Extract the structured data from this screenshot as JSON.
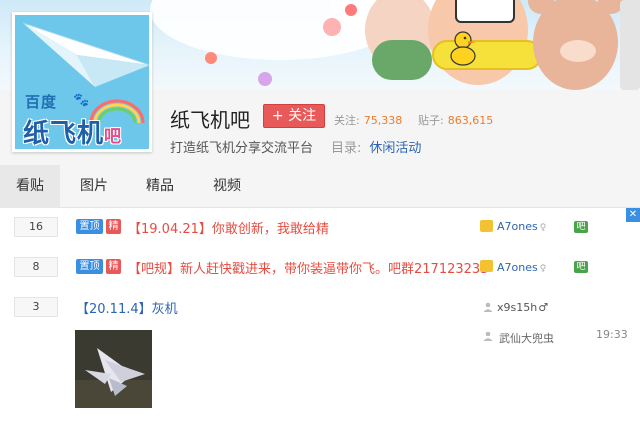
{
  "forum": {
    "name": "纸飞机吧",
    "slogan": "打造纸飞机分享交流平台",
    "logo_sub": "百度",
    "logo_main": "纸飞机",
    "logo_suffix": "吧"
  },
  "follow_button": {
    "label": "+ 关注"
  },
  "stats": {
    "followers_label": "关注:",
    "followers_value": "75,338",
    "posts_label": "贴子:",
    "posts_value": "863,615"
  },
  "catalog": {
    "label": "目录:",
    "value": "休闲活动"
  },
  "tabs": [
    {
      "label": "看贴",
      "active": true
    },
    {
      "label": "图片",
      "active": false
    },
    {
      "label": "精品",
      "active": false
    },
    {
      "label": "视频",
      "active": false
    }
  ],
  "threads": [
    {
      "replies": "16",
      "badge_top": "置顶",
      "badge_jing": "精",
      "title": "【19.04.21】你敢创新，我敢给精",
      "author": "A7ones",
      "author_tail": "♀",
      "forum_icon": "吧"
    },
    {
      "replies": "8",
      "badge_top": "置顶",
      "badge_jing": "精",
      "title": "【吧规】新人赶快戳进来，带你装逼带你飞。吧群217123233",
      "author": "A7ones",
      "author_tail": "♀",
      "forum_icon": "吧"
    },
    {
      "replies": "3",
      "title": "【20.11.4】灰机",
      "author": "x9s15h",
      "author_sex": "♂",
      "last_reply_user": "武仙大兜虫",
      "last_reply_time": "19:33"
    }
  ],
  "colors": {
    "accent_blue": "#2d64b3",
    "title_red": "#e54d42",
    "follow_red": "#e85a5a",
    "stat_orange": "#f07b2a",
    "top_badge_blue": "#3b8fe0"
  },
  "icons": {
    "close": "close-icon",
    "member": "member-icon",
    "forum_level": "forum-level-icon",
    "person": "person-icon"
  }
}
